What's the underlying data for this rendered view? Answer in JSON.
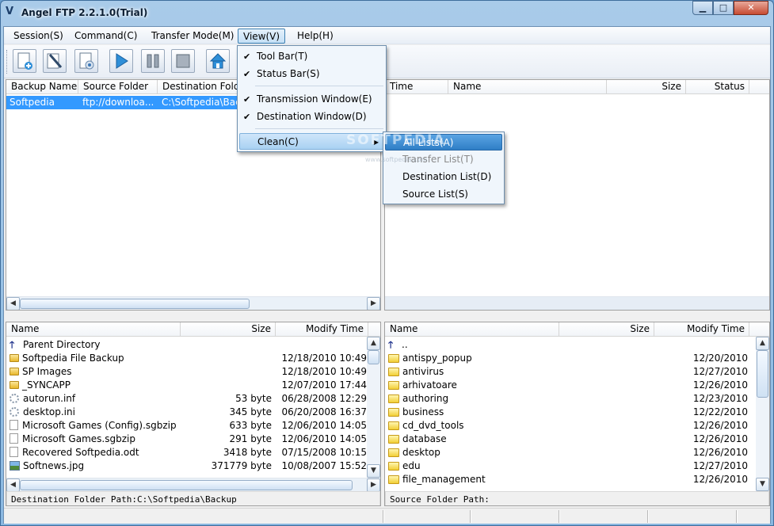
{
  "window": {
    "title": "Angel FTP 2.2.1.0(Trial)",
    "min": "▁",
    "max": "□",
    "close": "✕"
  },
  "menubar": [
    {
      "label": "Session(S)"
    },
    {
      "label": "Command(C)"
    },
    {
      "label": "Transfer Mode(M)"
    },
    {
      "label": "View(V)"
    },
    {
      "label": "Help(H)"
    }
  ],
  "toolbar": {
    "buttons": [
      "new-backup-icon",
      "edit-icon",
      "properties-icon",
      "start-icon",
      "pause-icon",
      "stop-icon",
      "home-icon"
    ]
  },
  "backup_list": {
    "columns": [
      "Backup Name",
      "Source Folder",
      "Destination Folder"
    ],
    "rows": [
      {
        "name": "Softpedia",
        "source": "ftp://downloa...",
        "destination": "C:\\Softpedia\\Back"
      }
    ]
  },
  "transfer_list": {
    "columns": [
      "Time",
      "Name",
      "Size",
      "Status"
    ]
  },
  "local_files": {
    "columns": [
      "Name",
      "Size",
      "Modify Time"
    ],
    "rows": [
      {
        "icon": "up",
        "name": "Parent Directory",
        "size": "",
        "time": ""
      },
      {
        "icon": "folder",
        "name": "Softpedia File Backup",
        "size": "",
        "time": "12/18/2010 10:49"
      },
      {
        "icon": "folder",
        "name": "SP Images",
        "size": "",
        "time": "12/18/2010 10:49"
      },
      {
        "icon": "folder",
        "name": "_SYNCAPP",
        "size": "",
        "time": "12/07/2010 17:44"
      },
      {
        "icon": "gear",
        "name": "autorun.inf",
        "size": "53 byte",
        "time": "06/28/2008 12:29"
      },
      {
        "icon": "gear",
        "name": "desktop.ini",
        "size": "345 byte",
        "time": "06/20/2008 16:37"
      },
      {
        "icon": "file",
        "name": "Microsoft Games (Config).sgbzip",
        "size": "633 byte",
        "time": "12/06/2010 14:05"
      },
      {
        "icon": "file",
        "name": "Microsoft Games.sgbzip",
        "size": "291 byte",
        "time": "12/06/2010 14:05"
      },
      {
        "icon": "file",
        "name": "Recovered Softpedia.odt",
        "size": "3418 byte",
        "time": "07/15/2008 10:15"
      },
      {
        "icon": "image",
        "name": "Softnews.jpg",
        "size": "371779 byte",
        "time": "10/08/2007 15:52"
      }
    ],
    "path_label": "Destination Folder Path:C:\\Softpedia\\Backup"
  },
  "remote_files": {
    "columns": [
      "Name",
      "Size",
      "Modify Time"
    ],
    "rows": [
      {
        "icon": "up",
        "name": "..",
        "time": ""
      },
      {
        "icon": "folder",
        "name": "antispy_popup",
        "time": "12/20/2010"
      },
      {
        "icon": "folder",
        "name": "antivirus",
        "time": "12/27/2010"
      },
      {
        "icon": "folder",
        "name": "arhivatoare",
        "time": "12/26/2010"
      },
      {
        "icon": "folder",
        "name": "authoring",
        "time": "12/23/2010"
      },
      {
        "icon": "folder",
        "name": "business",
        "time": "12/22/2010"
      },
      {
        "icon": "folder",
        "name": "cd_dvd_tools",
        "time": "12/26/2010"
      },
      {
        "icon": "folder",
        "name": "database",
        "time": "12/26/2010"
      },
      {
        "icon": "folder",
        "name": "desktop",
        "time": "12/26/2010"
      },
      {
        "icon": "folder",
        "name": "edu",
        "time": "12/27/2010"
      },
      {
        "icon": "folder",
        "name": "file_management",
        "time": "12/26/2010"
      }
    ],
    "path_label": "Source Folder Path:"
  },
  "view_menu": {
    "items": [
      {
        "label": "Tool Bar(T)",
        "checked": "✔"
      },
      {
        "label": "Status Bar(S)",
        "checked": "✔"
      },
      {
        "label": "Transmission Window(E)",
        "checked": "✔"
      },
      {
        "label": "Destination Window(D)",
        "checked": "✔"
      },
      {
        "label": "Clean(C)",
        "submenu": "▶"
      }
    ]
  },
  "clean_submenu": {
    "items": [
      {
        "label": "All Lists(A)"
      },
      {
        "label": "Transfer List(T)"
      },
      {
        "label": "Destination List(D)"
      },
      {
        "label": "Source List(S)"
      }
    ]
  },
  "watermark": {
    "text": "SOFTPEDIA",
    "url": "www.softpedia.com"
  }
}
